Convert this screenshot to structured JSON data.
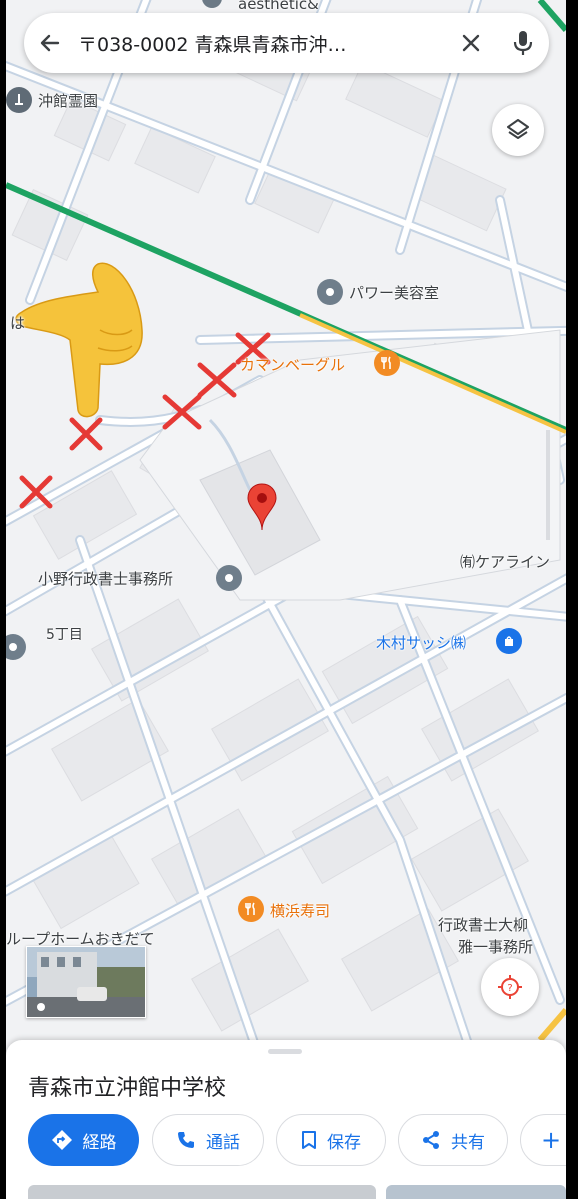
{
  "search": {
    "query": "〒038-0002 青森県青森市沖…"
  },
  "map": {
    "labels": {
      "top_partial": "aesthetic&",
      "cemetery": "沖館霊園",
      "beauty_salon": "パワー美容室",
      "bagel_shop": "カマンベーグル",
      "partial_left": "は",
      "scrivener_office": "小野行政書士事務所",
      "care": "㈲ケアライン",
      "block_5": "5丁目",
      "sash": "木村サッシ㈱",
      "sushi": "横浜寿司",
      "scrivener_right_1": "行政書士大柳",
      "scrivener_right_2": "雅一事務所",
      "group_home": "ループホームおきだて"
    }
  },
  "place": {
    "name": "青森市立沖館中学校"
  },
  "actions": {
    "directions": "経路",
    "call": "通話",
    "save": "保存",
    "share": "共有",
    "more": "+"
  },
  "colors": {
    "accent": "#1a73e8",
    "pin": "#ea4335",
    "highway": "#1ea362",
    "annotation_cross": "#e53935",
    "poi_orange": "#f28b23",
    "poi_blue": "#1a73e8"
  },
  "icons": [
    "back-arrow-icon",
    "close-icon",
    "mic-icon",
    "layers-icon",
    "location-pin-icon",
    "pointing-hand-icon",
    "locate-icon",
    "directions-icon",
    "phone-icon",
    "bookmark-icon",
    "share-icon"
  ]
}
